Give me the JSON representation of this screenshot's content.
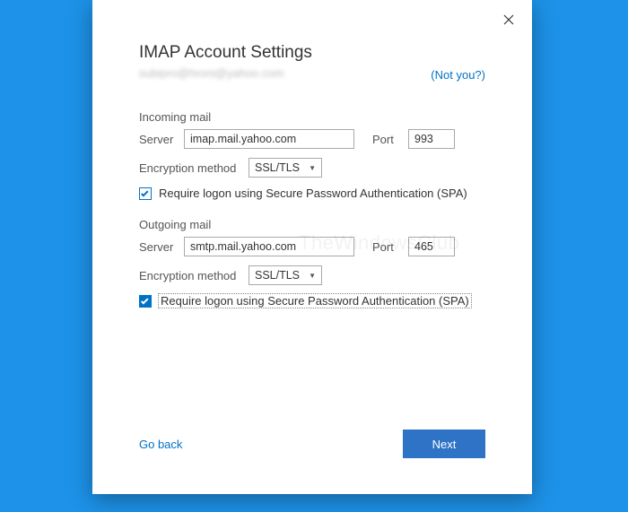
{
  "title": "IMAP Account Settings",
  "email_masked": "subipro@hroni@yahoo.com",
  "notyou": "(Not you?)",
  "incoming": {
    "heading": "Incoming mail",
    "server_label": "Server",
    "server": "imap.mail.yahoo.com",
    "port_label": "Port",
    "port": "993",
    "enc_label": "Encryption method",
    "enc_value": "SSL/TLS",
    "spa_label": "Require logon using Secure Password Authentication (SPA)"
  },
  "outgoing": {
    "heading": "Outgoing mail",
    "server_label": "Server",
    "server": "smtp.mail.yahoo.com",
    "port_label": "Port",
    "port": "465",
    "enc_label": "Encryption method",
    "enc_value": "SSL/TLS",
    "spa_label": "Require logon using Secure Password Authentication (SPA)"
  },
  "footer": {
    "goback": "Go back",
    "next": "Next"
  },
  "watermark": "TheWindowsClub"
}
